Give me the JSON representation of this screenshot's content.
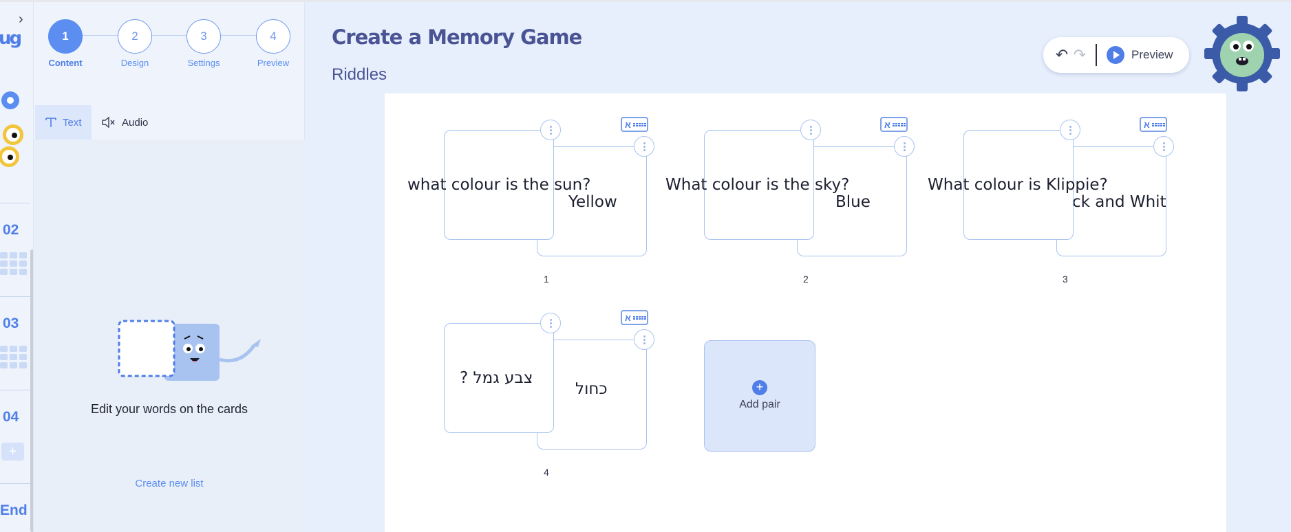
{
  "rail": {
    "sections": [
      "02",
      "03",
      "04",
      "End"
    ]
  },
  "stepper": {
    "steps": [
      {
        "num": "1",
        "label": "Content"
      },
      {
        "num": "2",
        "label": "Design"
      },
      {
        "num": "3",
        "label": "Settings"
      },
      {
        "num": "4",
        "label": "Preview"
      }
    ]
  },
  "tabs": {
    "text_label": "Text",
    "audio_label": "Audio"
  },
  "panel": {
    "hint": "Edit your words on the cards",
    "create_list": "Create new list"
  },
  "header": {
    "title": "Create a Memory Game",
    "subtitle": "Riddles",
    "preview_label": "Preview"
  },
  "pairs": [
    {
      "num": "1",
      "front": "what colour is the sun?",
      "back": "Yellow",
      "keyboard": "א"
    },
    {
      "num": "2",
      "front": "What colour is the sky?",
      "back": "Blue",
      "keyboard": "א"
    },
    {
      "num": "3",
      "front": "What colour is Klippie?",
      "back": "ck and White",
      "keyboard": "א"
    },
    {
      "num": "4",
      "front": "צבע גמל  ?",
      "back": "כחול",
      "keyboard": "א"
    }
  ],
  "add_pair_label": "Add pair",
  "colors": {
    "accent": "#5b8ef0",
    "title": "#4a5494",
    "background": "#e7eefc"
  }
}
